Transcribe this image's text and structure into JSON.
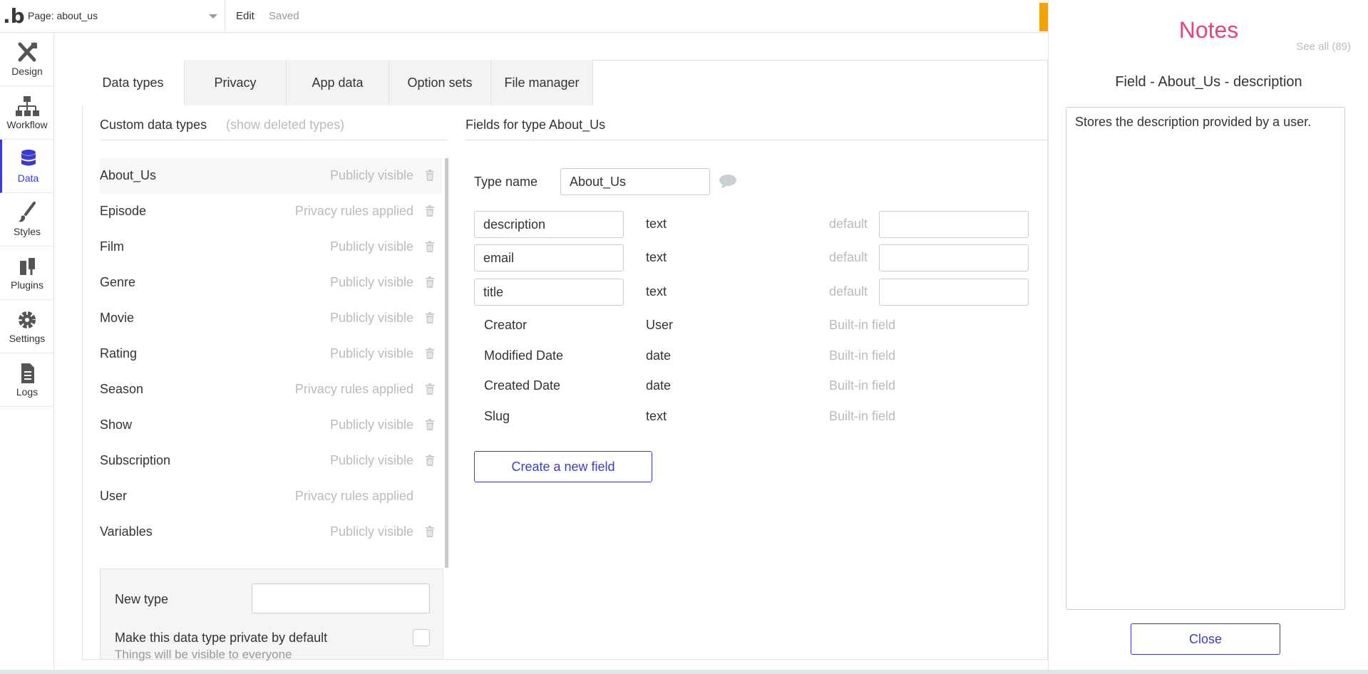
{
  "topbar": {
    "logo": ".b",
    "page_label": "Page: about_us",
    "edit_label": "Edit",
    "saved_label": "Saved"
  },
  "sidebar": {
    "items": [
      {
        "label": "Design",
        "icon": "design-icon"
      },
      {
        "label": "Workflow",
        "icon": "workflow-icon"
      },
      {
        "label": "Data",
        "icon": "database-icon",
        "active": true
      },
      {
        "label": "Styles",
        "icon": "brush-icon"
      },
      {
        "label": "Plugins",
        "icon": "plug-icon"
      },
      {
        "label": "Settings",
        "icon": "gear-icon"
      },
      {
        "label": "Logs",
        "icon": "document-icon"
      }
    ]
  },
  "tabs": [
    {
      "label": "Data types",
      "active": true
    },
    {
      "label": "Privacy"
    },
    {
      "label": "App data"
    },
    {
      "label": "Option sets"
    },
    {
      "label": "File manager"
    }
  ],
  "custom_types": {
    "title": "Custom data types",
    "show_deleted": "(show deleted types)",
    "items": [
      {
        "name": "About_Us",
        "visibility": "Publicly visible",
        "trash": true,
        "selected": true
      },
      {
        "name": "Episode",
        "visibility": "Privacy rules applied",
        "trash": true
      },
      {
        "name": "Film",
        "visibility": "Publicly visible",
        "trash": true
      },
      {
        "name": "Genre",
        "visibility": "Publicly visible",
        "trash": true
      },
      {
        "name": "Movie",
        "visibility": "Publicly visible",
        "trash": true
      },
      {
        "name": "Rating",
        "visibility": "Publicly visible",
        "trash": true
      },
      {
        "name": "Season",
        "visibility": "Privacy rules applied",
        "trash": true
      },
      {
        "name": "Show",
        "visibility": "Publicly visible",
        "trash": true
      },
      {
        "name": "Subscription",
        "visibility": "Publicly visible",
        "trash": true
      },
      {
        "name": "User",
        "visibility": "Privacy rules applied",
        "trash": false
      },
      {
        "name": "Variables",
        "visibility": "Publicly visible",
        "trash": true
      }
    ],
    "new_type_label": "New type",
    "new_type_value": "",
    "private_label": "Make this data type private by default",
    "private_sub": "Things will be visible to everyone"
  },
  "fields": {
    "title": "Fields for type About_Us",
    "type_name_label": "Type name",
    "type_name_value": "About_Us",
    "editable": [
      {
        "name": "description",
        "type": "text",
        "default_label": "default",
        "default_value": ""
      },
      {
        "name": "email",
        "type": "text",
        "default_label": "default",
        "default_value": ""
      },
      {
        "name": "title",
        "type": "text",
        "default_label": "default",
        "default_value": ""
      }
    ],
    "builtin": [
      {
        "name": "Creator",
        "type": "User",
        "note": "Built-in field"
      },
      {
        "name": "Modified Date",
        "type": "date",
        "note": "Built-in field"
      },
      {
        "name": "Created Date",
        "type": "date",
        "note": "Built-in field"
      },
      {
        "name": "Slug",
        "type": "text",
        "note": "Built-in field"
      }
    ],
    "create_button": "Create a new field"
  },
  "notes": {
    "title": "Notes",
    "see_all": "See all (89)",
    "field_title": "Field - About_Us - description",
    "text": "Stores the description provided by a user.",
    "close_button": "Close"
  },
  "colors": {
    "accent": "#3b3bd4",
    "notes_title": "#e8457a",
    "muted": "#bbbbbb",
    "orange": "#f0a500"
  }
}
